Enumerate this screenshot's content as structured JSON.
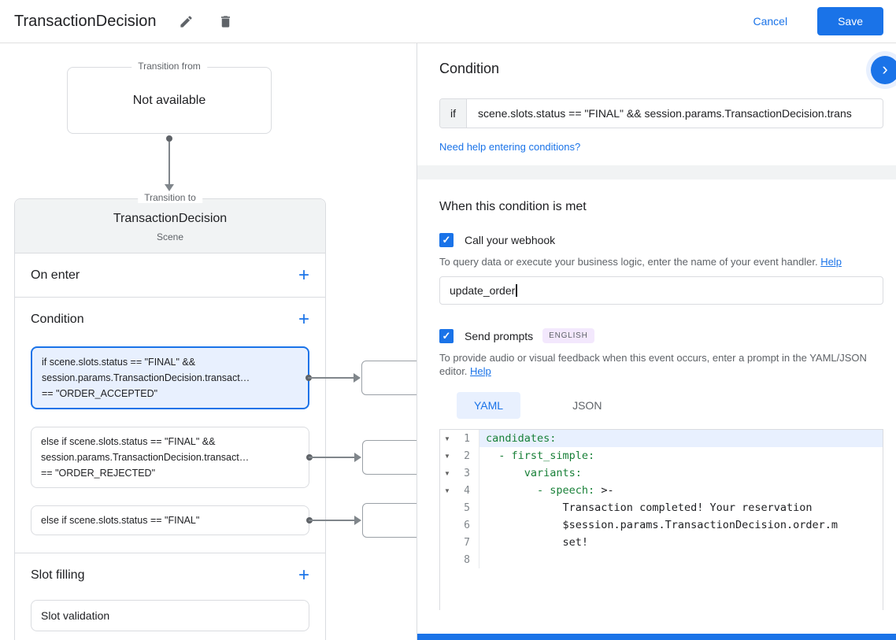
{
  "header": {
    "title": "TransactionDecision",
    "cancel_label": "Cancel",
    "save_label": "Save"
  },
  "diagram": {
    "transition_from": {
      "label": "Transition from",
      "content": "Not available"
    },
    "transition_to": {
      "label": "Transition to",
      "title": "TransactionDecision",
      "subtitle": "Scene"
    },
    "sections": {
      "on_enter": "On enter",
      "condition": "Condition",
      "slot_filling": "Slot filling",
      "slot_validation": "Slot validation"
    },
    "conditions": [
      {
        "selected": true,
        "lines": [
          "if scene.slots.status == \"FINAL\" &&",
          "session.params.TransactionDecision.transact…",
          "== \"ORDER_ACCEPTED\""
        ]
      },
      {
        "selected": false,
        "lines": [
          "else if scene.slots.status == \"FINAL\" &&",
          "session.params.TransactionDecision.transact…",
          "== \"ORDER_REJECTED\""
        ]
      },
      {
        "selected": false,
        "lines": [
          "else if scene.slots.status == \"FINAL\""
        ]
      }
    ]
  },
  "panel": {
    "condition_heading": "Condition",
    "if_label": "if",
    "condition_value": "scene.slots.status == \"FINAL\" && session.params.TransactionDecision.trans",
    "conditions_help_link": "Need help entering conditions?",
    "when_met_heading": "When this condition is met",
    "webhook": {
      "label": "Call your webhook",
      "description": "To query data or execute your business logic, enter the name of your event handler. ",
      "help_label": "Help",
      "value": "update_order"
    },
    "prompts": {
      "label": "Send prompts",
      "badge": "ENGLISH",
      "description": "To provide audio or visual feedback when this event occurs, enter a prompt in the YAML/JSON editor. ",
      "help_label": "Help"
    },
    "tabs": [
      {
        "label": "YAML",
        "active": true
      },
      {
        "label": "JSON",
        "active": false
      }
    ]
  },
  "editor": {
    "lines": [
      {
        "number": 1,
        "fold": true,
        "highlighted": true,
        "segments": [
          [
            "key",
            "candidates:"
          ]
        ]
      },
      {
        "number": 2,
        "fold": true,
        "highlighted": false,
        "segments": [
          [
            "plain",
            "  "
          ],
          [
            "key",
            "- first_simple:"
          ]
        ]
      },
      {
        "number": 3,
        "fold": true,
        "highlighted": false,
        "segments": [
          [
            "plain",
            "      "
          ],
          [
            "key",
            "variants:"
          ]
        ]
      },
      {
        "number": 4,
        "fold": true,
        "highlighted": false,
        "segments": [
          [
            "plain",
            "        "
          ],
          [
            "key",
            "- speech:"
          ],
          [
            "plain",
            " >-"
          ]
        ]
      },
      {
        "number": 5,
        "fold": false,
        "highlighted": false,
        "segments": [
          [
            "plain",
            "            Transaction completed! Your reservation"
          ]
        ]
      },
      {
        "number": 6,
        "fold": false,
        "highlighted": false,
        "segments": [
          [
            "plain",
            "            $session.params.TransactionDecision.order.m"
          ]
        ]
      },
      {
        "number": 7,
        "fold": false,
        "highlighted": false,
        "segments": [
          [
            "plain",
            "            set!"
          ]
        ]
      },
      {
        "number": 8,
        "fold": false,
        "highlighted": false,
        "segments": [
          [
            "plain",
            ""
          ]
        ]
      }
    ]
  },
  "colors": {
    "accent_blue": "#1a73e8",
    "selection_blue": "#e8f0fe",
    "border_gray": "#dadce0",
    "code_key_green": "#188038",
    "badge_purple_bg": "#f3e8fd"
  }
}
